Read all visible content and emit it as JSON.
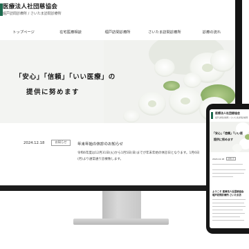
{
  "site": {
    "org_name": "医療法人社団慈協会",
    "org_sub": "堀戸訪問診療所 / さいたま訪問診療所"
  },
  "nav": {
    "items": [
      "トップページ",
      "在宅医療相談",
      "堀戸訪問診療所",
      "さいたま訪問診療所",
      "診療の流れ"
    ]
  },
  "hero": {
    "line1": "「安心」「信頼」「いい医療」の",
    "line2": "提供に努めます"
  },
  "news": {
    "date": "2024.12.18",
    "badge": "お知らせ",
    "title": "年末年始の休診のお知らせ",
    "body1": "令和6年度は12月31日(火)から1月5日(日)までが年末年始の休診日となります。1月6日",
    "body2": "(月)より通常通り診療致します。"
  },
  "phone": {
    "org_name": "医療法人社団慈協会",
    "org_sub": "堀戸訪問診療所 / さいたま訪問診療所",
    "hero_line1": "「安心」「信頼」「いい医",
    "hero_line2": "提供に努めます",
    "news_date": "2024.12.18",
    "news_badge": "お知らせ",
    "welcome1": "ようこそ 医療法人社団慈協会",
    "welcome2": "堀戸訪問診療所 さいたま訪"
  },
  "colors": {
    "brand_green": "#1e6a4e",
    "monitor_frame": "#141414"
  }
}
